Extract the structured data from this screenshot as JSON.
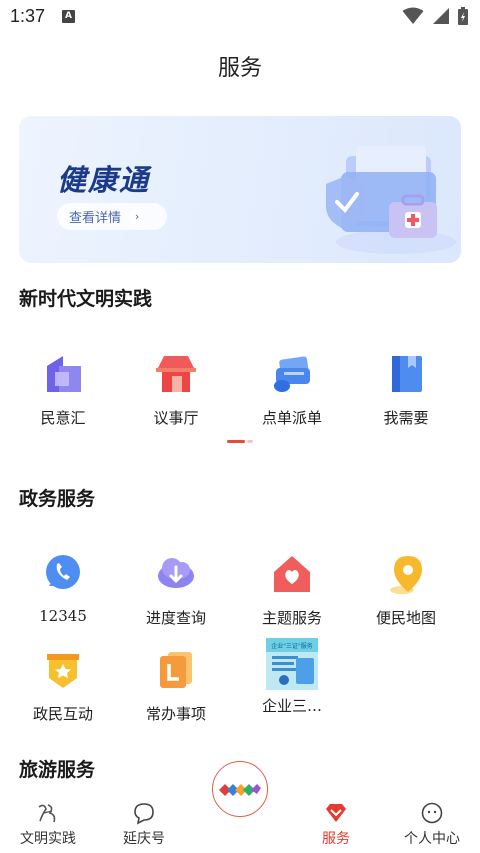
{
  "status": {
    "time": "1:37",
    "notif_badge": "A"
  },
  "page": {
    "title": "服务"
  },
  "banner": {
    "title": "健康通",
    "button": "查看详情",
    "chevron": "›"
  },
  "sections": {
    "civilization": {
      "title": "新时代文明实践",
      "items": [
        {
          "label": "民意汇",
          "icon": "building-icon"
        },
        {
          "label": "议事厅",
          "icon": "meeting-hall-icon"
        },
        {
          "label": "点单派单",
          "icon": "order-dispatch-icon"
        },
        {
          "label": "我需要",
          "icon": "book-icon"
        }
      ]
    },
    "government": {
      "title": "政务服务",
      "items": [
        {
          "label": "12345",
          "icon": "phone-icon"
        },
        {
          "label": "进度查询",
          "icon": "cloud-download-icon"
        },
        {
          "label": "主题服务",
          "icon": "home-heart-icon"
        },
        {
          "label": "便民地图",
          "icon": "map-pin-icon"
        },
        {
          "label": "政民互动",
          "icon": "badge-star-icon"
        },
        {
          "label": "常办事项",
          "icon": "document-l-icon"
        },
        {
          "label": "企业三…",
          "icon": "poster-thumbnail-icon",
          "thumb_text": "企业\"三证\"服务"
        }
      ]
    },
    "tourism": {
      "title": "旅游服务"
    }
  },
  "tabbar": {
    "items": [
      {
        "label": "文明实践",
        "icon": "calligraphy-icon"
      },
      {
        "label": "延庆号",
        "icon": "chat-bubble-icon"
      },
      {
        "label": "",
        "icon": "center-logo-icon"
      },
      {
        "label": "服务",
        "icon": "diamond-icon",
        "active": true
      },
      {
        "label": "个人中心",
        "icon": "face-icon"
      }
    ]
  },
  "colors": {
    "accent": "#e53a2f",
    "banner_title": "#1b3a8a"
  }
}
